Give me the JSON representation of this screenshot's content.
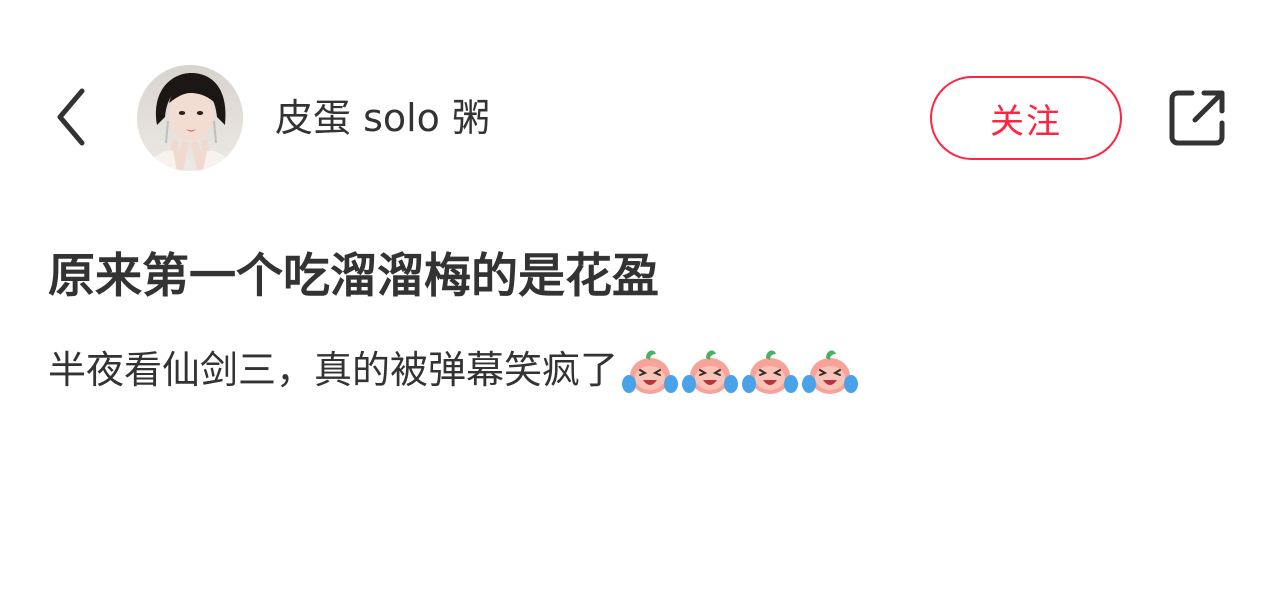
{
  "header": {
    "username": "皮蛋 solo 粥",
    "follow_label": "关注",
    "icons": {
      "back": "chevron-left-icon",
      "share": "share-external-icon"
    }
  },
  "post": {
    "title": "原来第一个吃溜溜梅的是花盈",
    "body": "半夜看仙剑三，真的被弹幕笑疯了",
    "emojis": [
      "laughing-crying-emoji",
      "laughing-crying-emoji",
      "laughing-crying-emoji",
      "laughing-crying-emoji"
    ]
  },
  "colors": {
    "accent": "#ff2442",
    "text": "#333333",
    "background": "#ffffff"
  }
}
